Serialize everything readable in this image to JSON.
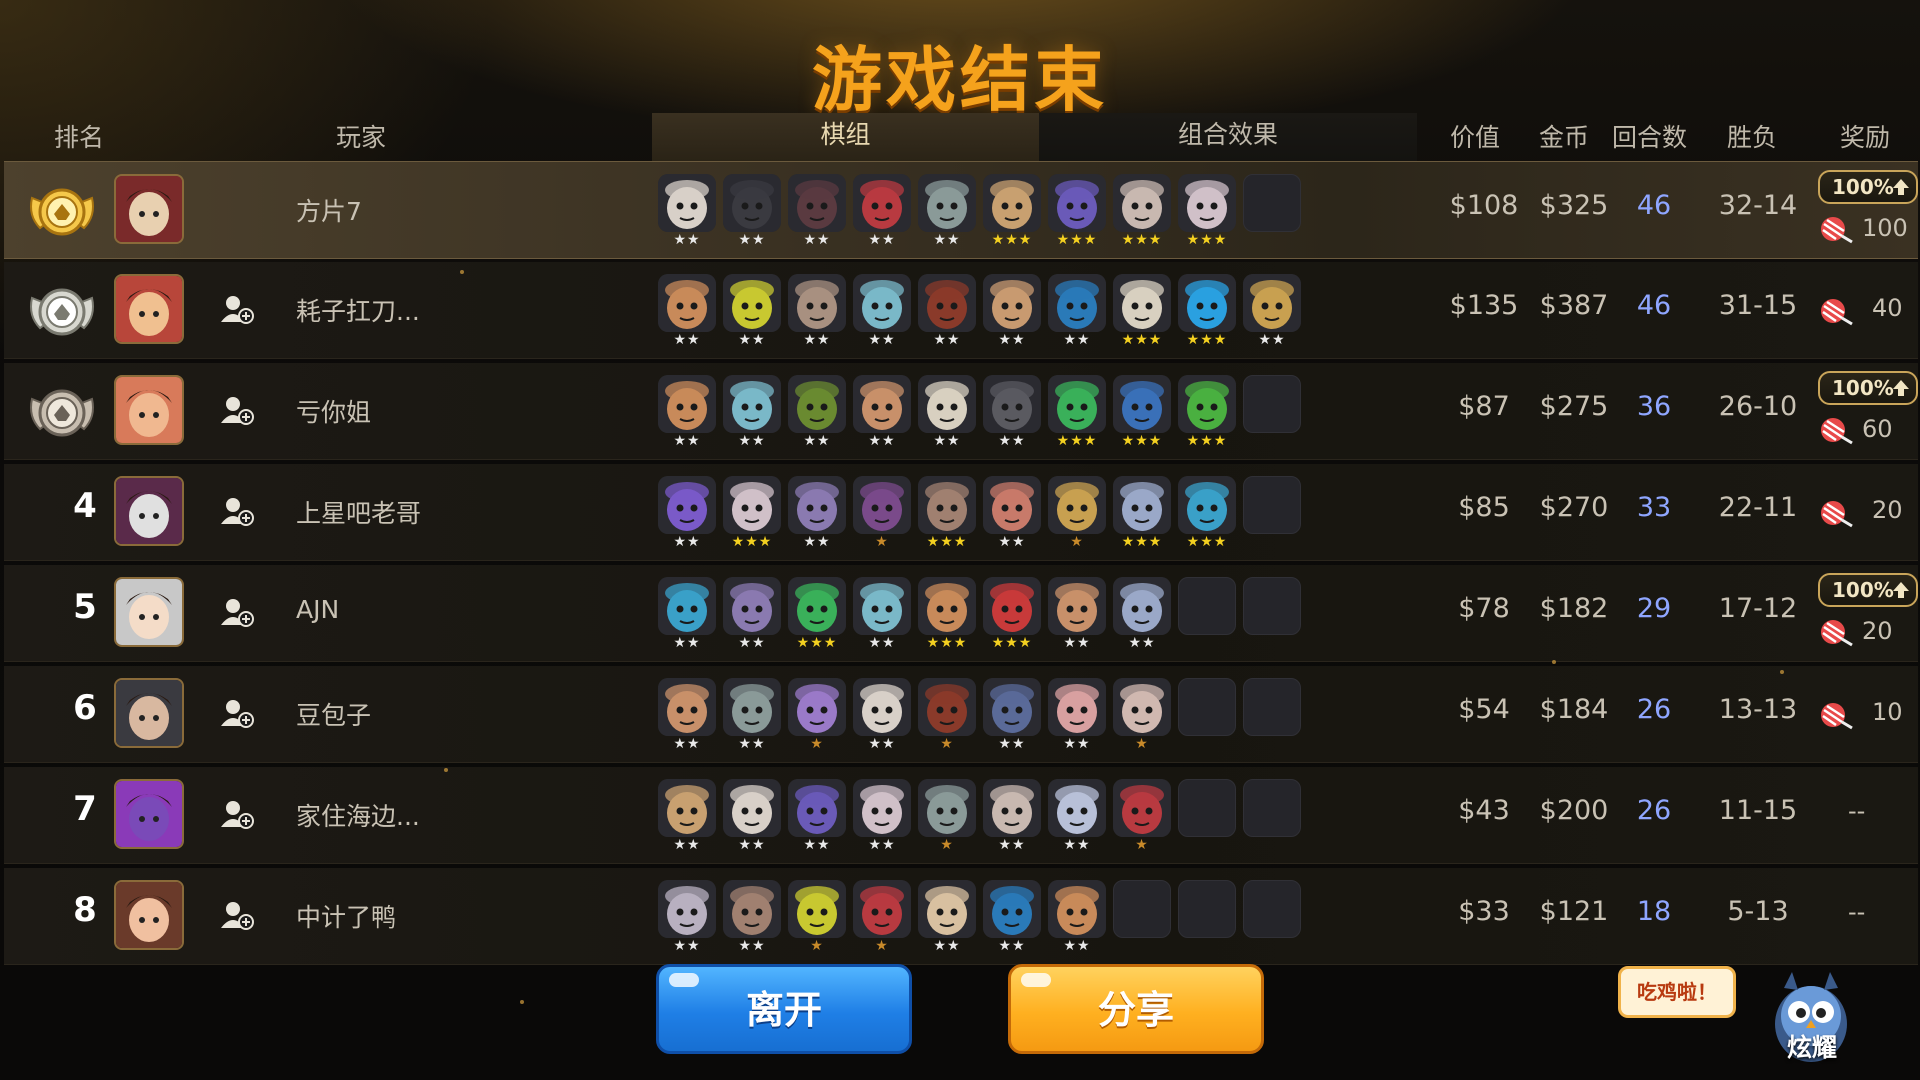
{
  "title": "游戏结束",
  "headers": {
    "rank": "排名",
    "player": "玩家",
    "lineup_tab": "棋组",
    "combo_tab": "组合效果",
    "value": "价值",
    "gold": "金币",
    "rounds": "回合数",
    "record": "胜负",
    "reward": "奖励"
  },
  "colors": {
    "accent_orange": "#f5a21c",
    "rounds_blue": "#8fa6ff",
    "star_gold": "#f3d020",
    "star_silver": "#e8e8e8",
    "star_bronze": "#c88a2a",
    "leave_button": "#1f7fe6",
    "share_button": "#ffb020"
  },
  "players": [
    {
      "rank": "1",
      "medal": "gold-medal-icon",
      "name": "方片7",
      "me": true,
      "add_friend": false,
      "pieces": [
        2,
        2,
        2,
        2,
        2,
        3,
        3,
        3,
        3,
        0
      ],
      "piece_colors": [
        "#d8d0c8",
        "#3a3a40",
        "#5a3a40",
        "#b83a40",
        "#8a9a98",
        "#c8a070",
        "#6a5ab8",
        "#c8b8b0",
        "#d0c0c8",
        ""
      ],
      "value": "$108",
      "gold": "$325",
      "rounds": "46",
      "record": "32-14",
      "boost": "100%",
      "reward": "100"
    },
    {
      "rank": "2",
      "medal": "silver-medal-icon",
      "name": "耗子扛刀...",
      "me": false,
      "add_friend": true,
      "pieces": [
        2,
        2,
        2,
        2,
        2,
        2,
        2,
        3,
        3,
        2
      ],
      "piece_colors": [
        "#c88a5a",
        "#c8c830",
        "#a89080",
        "#7ab8c8",
        "#8a3a2a",
        "#c89a70",
        "#2a7ab8",
        "#d8d0c0",
        "#2aa0e0",
        "#c8a050"
      ],
      "value": "$135",
      "gold": "$387",
      "rounds": "46",
      "record": "31-15",
      "boost": "",
      "reward": "40"
    },
    {
      "rank": "3",
      "medal": "bronze-medal-icon",
      "name": "亏你姐",
      "me": false,
      "add_friend": true,
      "pieces": [
        2,
        2,
        2,
        2,
        2,
        2,
        3,
        3,
        3,
        0
      ],
      "piece_colors": [
        "#c88a5a",
        "#7ab8c8",
        "#6a8a30",
        "#c8906a",
        "#d8d0c0",
        "#5a5a60",
        "#3ab05a",
        "#3a70b8",
        "#4ab040",
        ""
      ],
      "value": "$87",
      "gold": "$275",
      "rounds": "36",
      "record": "26-10",
      "boost": "100%",
      "reward": "60"
    },
    {
      "rank": "4",
      "medal": "",
      "name": "上星吧老哥",
      "me": false,
      "add_friend": true,
      "pieces": [
        2,
        3,
        2,
        1,
        3,
        2,
        1,
        3,
        3,
        0
      ],
      "piece_colors": [
        "#7a5ac8",
        "#d0c0c8",
        "#8a7ab0",
        "#7a4a8a",
        "#a08070",
        "#c87a6a",
        "#c8a050",
        "#9aa8c8",
        "#3aa0c8",
        ""
      ],
      "value": "$85",
      "gold": "$270",
      "rounds": "33",
      "record": "22-11",
      "boost": "",
      "reward": "20"
    },
    {
      "rank": "5",
      "medal": "",
      "name": "AJN",
      "me": false,
      "add_friend": true,
      "pieces": [
        2,
        2,
        3,
        2,
        3,
        3,
        2,
        2,
        0,
        0
      ],
      "piece_colors": [
        "#3aa0c8",
        "#8a7ab0",
        "#3ab05a",
        "#7ab8c8",
        "#c88a5a",
        "#c83a3a",
        "#c8906a",
        "#9aa8c8",
        "",
        ""
      ],
      "value": "$78",
      "gold": "$182",
      "rounds": "29",
      "record": "17-12",
      "boost": "100%",
      "reward": "20"
    },
    {
      "rank": "6",
      "medal": "",
      "name": "豆包子",
      "me": false,
      "add_friend": true,
      "pieces": [
        2,
        2,
        1,
        2,
        1,
        2,
        2,
        1,
        0,
        0
      ],
      "piece_colors": [
        "#c8906a",
        "#8a9a98",
        "#9a7ac8",
        "#d8d0c8",
        "#8a3a2a",
        "#5a6a98",
        "#d8a0a0",
        "#d0b8b0",
        "",
        ""
      ],
      "value": "$54",
      "gold": "$184",
      "rounds": "26",
      "record": "13-13",
      "boost": "",
      "reward": "10"
    },
    {
      "rank": "7",
      "medal": "",
      "name": "家住海边...",
      "me": false,
      "add_friend": true,
      "pieces": [
        2,
        2,
        2,
        2,
        1,
        2,
        2,
        1,
        0,
        0
      ],
      "piece_colors": [
        "#c8a070",
        "#d8d0c8",
        "#6a5ab8",
        "#d0c0c8",
        "#8a9a98",
        "#c8b8b0",
        "#b8c0d8",
        "#b83a40",
        "",
        ""
      ],
      "value": "$43",
      "gold": "$200",
      "rounds": "26",
      "record": "11-15",
      "boost": "",
      "reward": "--"
    },
    {
      "rank": "8",
      "medal": "",
      "name": "中计了鸭",
      "me": false,
      "add_friend": true,
      "pieces": [
        2,
        2,
        1,
        1,
        2,
        2,
        2,
        0,
        0,
        0
      ],
      "piece_colors": [
        "#b8b0c0",
        "#a08070",
        "#c8c830",
        "#b83a40",
        "#d8c0a0",
        "#2a7ab8",
        "#c88a5a",
        "",
        "",
        ""
      ],
      "value": "$33",
      "gold": "$121",
      "rounds": "18",
      "record": "5-13",
      "boost": "",
      "reward": "--"
    }
  ],
  "buttons": {
    "leave": "离开",
    "share": "分享"
  },
  "mascot": {
    "bubble": "吃鸡啦！",
    "label": "炫耀"
  }
}
